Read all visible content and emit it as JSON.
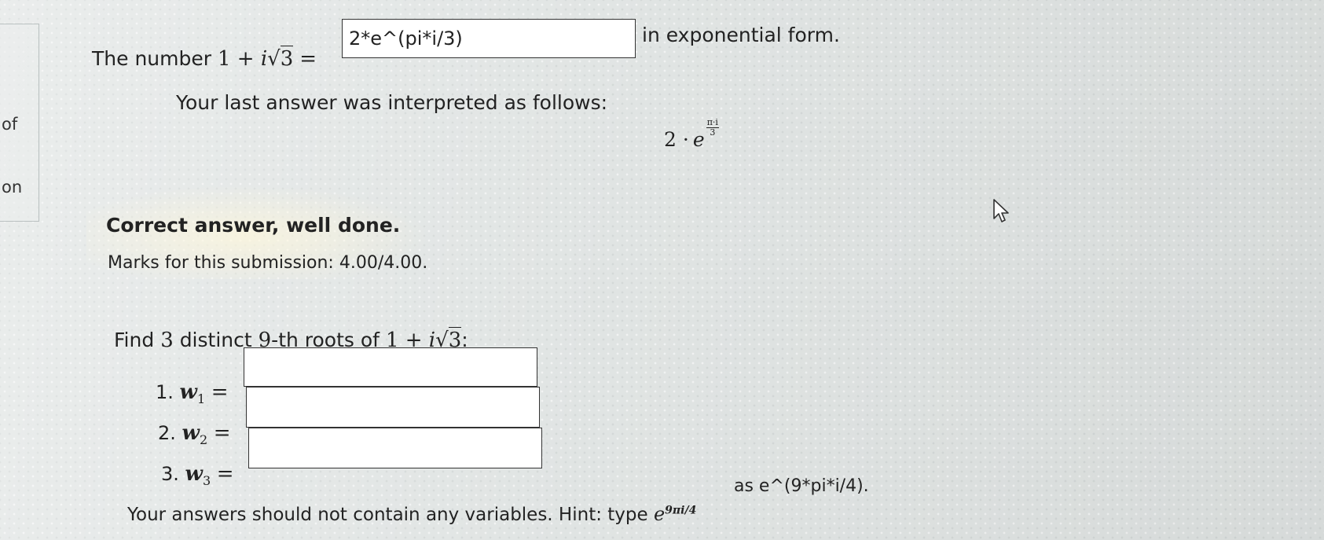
{
  "sidebar": {
    "word_of": "of",
    "word_on": "on"
  },
  "q1": {
    "prefix": "The number",
    "expr_lead": "1 + ",
    "expr_i": "i",
    "radical": "√",
    "radicand": "3",
    "equals": "=",
    "answer_value": "2*e^(pi*i/3)",
    "suffix": "in exponential form.",
    "interp_label": "Your last answer was interpreted as follows:",
    "interp_coef": "2 ·",
    "interp_base": "e",
    "interp_exp_num": "π·i",
    "interp_exp_den": "3"
  },
  "feedback": {
    "headline": "Correct answer, well done.",
    "marks": "Marks for this submission: 4.00/4.00."
  },
  "q2": {
    "prompt_lead": "Find",
    "prompt_n": "3",
    "prompt_mid": "distinct",
    "prompt_k": "9",
    "prompt_tail": "-th roots of",
    "prompt_expr_lead": "1 + ",
    "prompt_expr_i": "i",
    "prompt_radical": "√",
    "prompt_radicand": "3",
    "prompt_colon": ":",
    "roots": [
      {
        "num": "1.",
        "var": "w",
        "sub": "1",
        "eq": "=",
        "value": ""
      },
      {
        "num": "2.",
        "var": "w",
        "sub": "2",
        "eq": "=",
        "value": ""
      },
      {
        "num": "3.",
        "var": "w",
        "sub": "3",
        "eq": "=",
        "value": ""
      }
    ],
    "hint_lead": "Your answers should not contain any variables. Hint: type",
    "hint_base": "e",
    "hint_exp": "9πi/4",
    "hint_tail": "as e^(9*pi*i/4)."
  },
  "icons": {
    "cursor": "mouse-pointer-icon"
  }
}
